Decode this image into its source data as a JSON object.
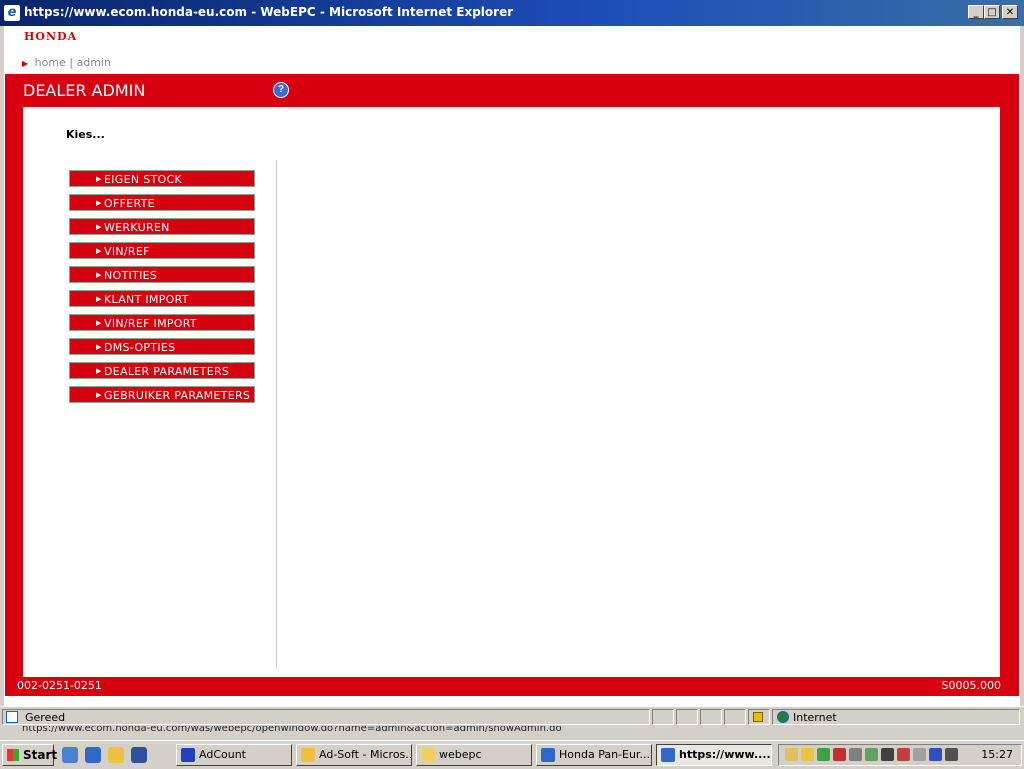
{
  "window": {
    "title": "https://www.ecom.honda-eu.com - WebEPC - Microsoft Internet Explorer",
    "minimize": "_",
    "maximize": "□",
    "close": "✕"
  },
  "header": {
    "logo": "HONDA",
    "nav": {
      "home": "home",
      "separator": "|",
      "admin": "admin"
    }
  },
  "panel": {
    "title": "DEALER ADMIN",
    "help": "?",
    "prompt": "Kies...",
    "menu": [
      {
        "label": "EIGEN STOCK"
      },
      {
        "label": "OFFERTE"
      },
      {
        "label": "WERKUREN"
      },
      {
        "label": "VIN/REF"
      },
      {
        "label": "NOTITIES"
      },
      {
        "label": "KLANT IMPORT"
      },
      {
        "label": "VIN/REF IMPORT"
      },
      {
        "label": "DMS-OPTIES"
      },
      {
        "label": "DEALER PARAMETERS"
      },
      {
        "label": "GEBRUIKER PARAMETERS"
      }
    ],
    "footer_left": "002-0251-0251",
    "footer_right": "S0005.000"
  },
  "statusbar": {
    "text": "Gereed",
    "zone": "Internet",
    "url_below": "https://www.ecom.honda-eu.com/was/webepc/openwindow.do?name=admin&action=admin/showAdmin.do"
  },
  "taskbar": {
    "start": "Start",
    "tasks": [
      {
        "label": "AdCount"
      },
      {
        "label": "Ad-Soft - Micros..."
      },
      {
        "label": "webepc"
      },
      {
        "label": "Honda Pan-Eur..."
      },
      {
        "label": "https://www...."
      }
    ],
    "clock": "15:27"
  },
  "colors": {
    "honda_red": "#d6000f",
    "titlebar_blue": "#0a246a"
  }
}
